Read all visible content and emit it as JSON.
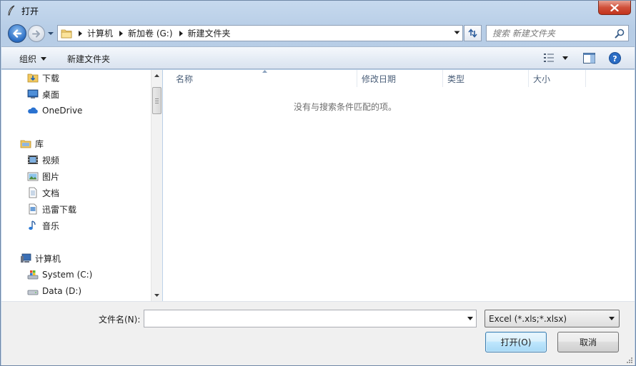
{
  "window": {
    "title": "打开",
    "app_icon": "feather-icon",
    "close_icon": "close-icon"
  },
  "address": {
    "breadcrumb": [
      "计算机",
      "新加卷 (G:)",
      "新建文件夹"
    ],
    "search_placeholder": "搜索 新建文件夹",
    "icons": [
      "back-arrow-icon",
      "forward-arrow-icon",
      "folder-icon",
      "refresh-icon",
      "search-icon"
    ]
  },
  "toolbar": {
    "organize_label": "组织",
    "new_folder_label": "新建文件夹",
    "icons": [
      "view-options-icon",
      "preview-pane-icon",
      "help-icon"
    ]
  },
  "nav": {
    "favorites": [
      {
        "label": "下载",
        "icon": "download-folder-icon"
      },
      {
        "label": "桌面",
        "icon": "desktop-icon"
      },
      {
        "label": "OneDrive",
        "icon": "onedrive-cloud-icon"
      }
    ],
    "libraries_label": "库",
    "libraries": [
      {
        "label": "视频",
        "icon": "video-icon"
      },
      {
        "label": "图片",
        "icon": "pictures-icon"
      },
      {
        "label": "文档",
        "icon": "documents-icon"
      },
      {
        "label": "迅雷下载",
        "icon": "thunder-download-icon"
      },
      {
        "label": "音乐",
        "icon": "music-icon"
      }
    ],
    "computer_label": "计算机",
    "drives": [
      {
        "label": "System (C:)",
        "icon": "system-drive-icon"
      },
      {
        "label": "Data (D:)",
        "icon": "drive-icon"
      }
    ]
  },
  "content": {
    "columns": [
      "名称",
      "修改日期",
      "类型",
      "大小"
    ],
    "sorted_column": "名称",
    "empty_message": "没有与搜索条件匹配的项。"
  },
  "footer": {
    "filename_label": "文件名(N):",
    "filename_value": "",
    "filetype_selected": "Excel (*.xls;*.xlsx)",
    "open_label": "打开(O)",
    "cancel_label": "取消"
  }
}
